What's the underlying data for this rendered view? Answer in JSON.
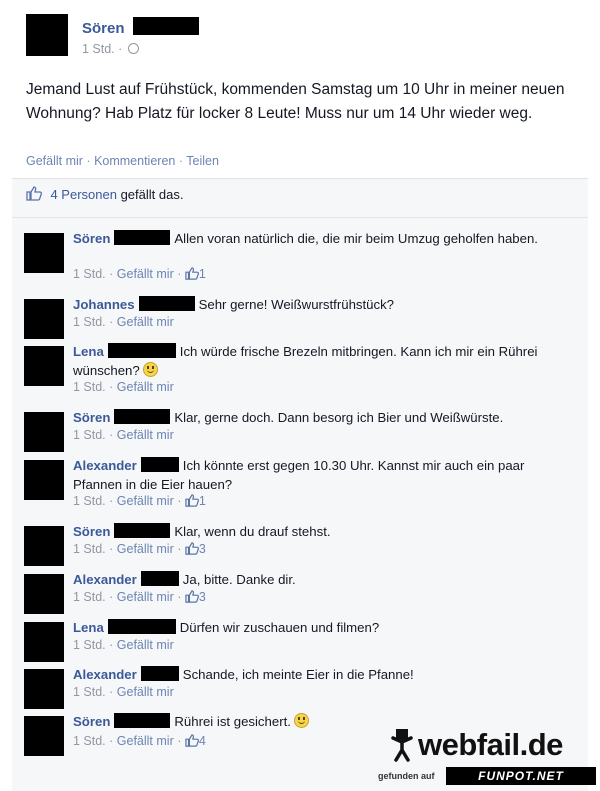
{
  "post": {
    "author": "Sören",
    "time": "1 Std. ·",
    "text": "Jemand Lust auf Frühstück, kommenden Samstag um 10 Uhr in meiner neuen Wohnung? Hab Platz für locker 8 Leute! Muss nur um 14 Uhr wieder weg.",
    "actions": {
      "like": "Gefällt mir",
      "sep": " · ",
      "comment": "Kommentieren",
      "share": "Teilen"
    }
  },
  "likes": {
    "count_link": "4 Personen",
    "text": " gefällt das."
  },
  "comments": [
    {
      "name": "Sören",
      "text": "Allen voran natürlich die, die mir beim Umzug geholfen haben.",
      "time": "1 Std. · ",
      "like": "Gefällt mir",
      "likes": "1"
    },
    {
      "name": "Johannes",
      "text": "Sehr gerne! Weißwurstfrühstück?",
      "time": "1 Std. · ",
      "like": "Gefällt mir",
      "likes": ""
    },
    {
      "name": "Lena",
      "text": "Ich würde frische Brezeln mitbringen. Kann ich mir ein Rührei wünschen?",
      "time": "1 Std. · ",
      "like": "Gefällt mir",
      "likes": ""
    },
    {
      "name": "Sören",
      "text": "Klar, gerne doch. Dann besorg ich Bier und Weißwürste.",
      "time": "1 Std. · ",
      "like": "Gefällt mir",
      "likes": ""
    },
    {
      "name": "Alexander",
      "text": "Ich könnte erst gegen 10.30 Uhr. Kannst mir auch ein paar Pfannen in die Eier hauen?",
      "time": "1 Std. · ",
      "like": "Gefällt mir",
      "likes": "1"
    },
    {
      "name": "Sören",
      "text": "Klar, wenn du drauf stehst.",
      "time": "1 Std. · ",
      "like": "Gefällt mir",
      "likes": "3"
    },
    {
      "name": "Alexander",
      "text": "Ja, bitte. Danke dir.",
      "time": "1 Std. · ",
      "like": "Gefällt mir",
      "likes": "3"
    },
    {
      "name": "Lena",
      "text": "Dürfen wir zuschauen und filmen?",
      "time": "1 Std. · ",
      "like": "Gefällt mir",
      "likes": ""
    },
    {
      "name": "Alexander",
      "text": "Schande, ich meinte Eier in die Pfanne!",
      "time": "1 Std. · ",
      "like": "Gefällt mir",
      "likes": ""
    },
    {
      "name": "Sören",
      "text": "Rührei ist gesichert.",
      "time": "1 Std. · ",
      "like": "Gefällt mir",
      "likes": "4"
    }
  ],
  "watermark": {
    "brand": "webfail.de",
    "found": "gefunden auf",
    "funpot": "FUNPOT.NET"
  },
  "colors": {
    "name": "#3b5998",
    "link": "#6d84b4",
    "meta": "#9197a3",
    "box_bg": "#f6f7f9"
  }
}
